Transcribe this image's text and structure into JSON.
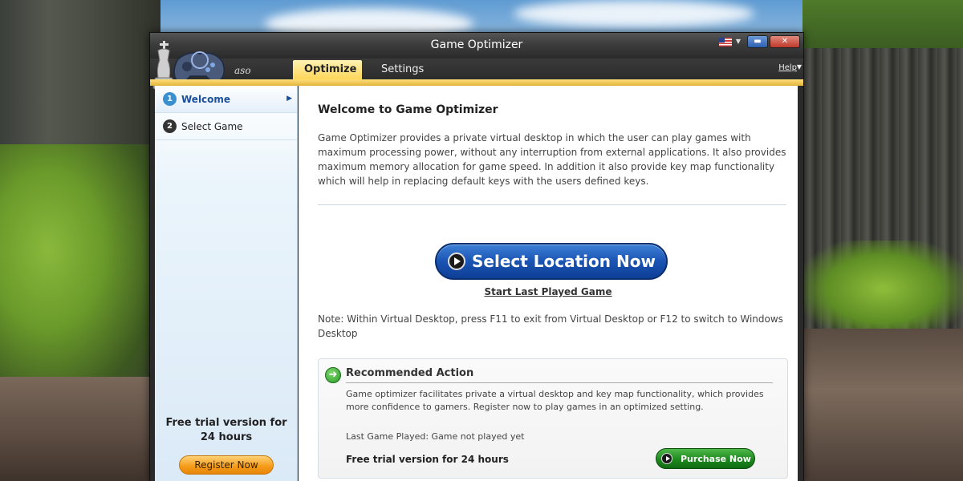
{
  "window": {
    "title": "Game Optimizer",
    "logo_text": "aso"
  },
  "tabs": {
    "optimize": "Optimize",
    "settings": "Settings",
    "help": "Help"
  },
  "sidebar": {
    "steps": [
      {
        "num": "1",
        "label": "Welcome"
      },
      {
        "num": "2",
        "label": "Select Game"
      }
    ],
    "trial_line1": "Free trial version for",
    "trial_line2": "24 hours",
    "register_label": "Register Now"
  },
  "main": {
    "title": "Welcome to Game Optimizer",
    "description": "Game Optimizer provides a private virtual desktop in which the user can play games with maximum processing power, without any interruption from external applications. It also provides maximum memory allocation for game speed. In addition it also provide key map functionality which will help in replacing default keys with the users defined keys.",
    "select_location_label": "Select Location Now",
    "start_last_label": "Start Last Played Game",
    "note": "Note: Within Virtual Desktop, press F11 to exit from Virtual Desktop or F12 to switch to Windows Desktop"
  },
  "recommended": {
    "title": "Recommended Action",
    "description": "Game optimizer facilitates private a virtual desktop and key map functionality, which provides more confidence to gamers. Register now to play games in an optimized setting.",
    "last_played": "Last Game Played: Game not played yet",
    "trial": "Free trial version for 24 hours",
    "purchase_label": "Purchase Now"
  },
  "colors": {
    "accent_yellow": "#ffd65a",
    "select_blue": "#1a54b3",
    "purchase_green": "#1e8a1e",
    "register_orange": "#f59a16"
  }
}
